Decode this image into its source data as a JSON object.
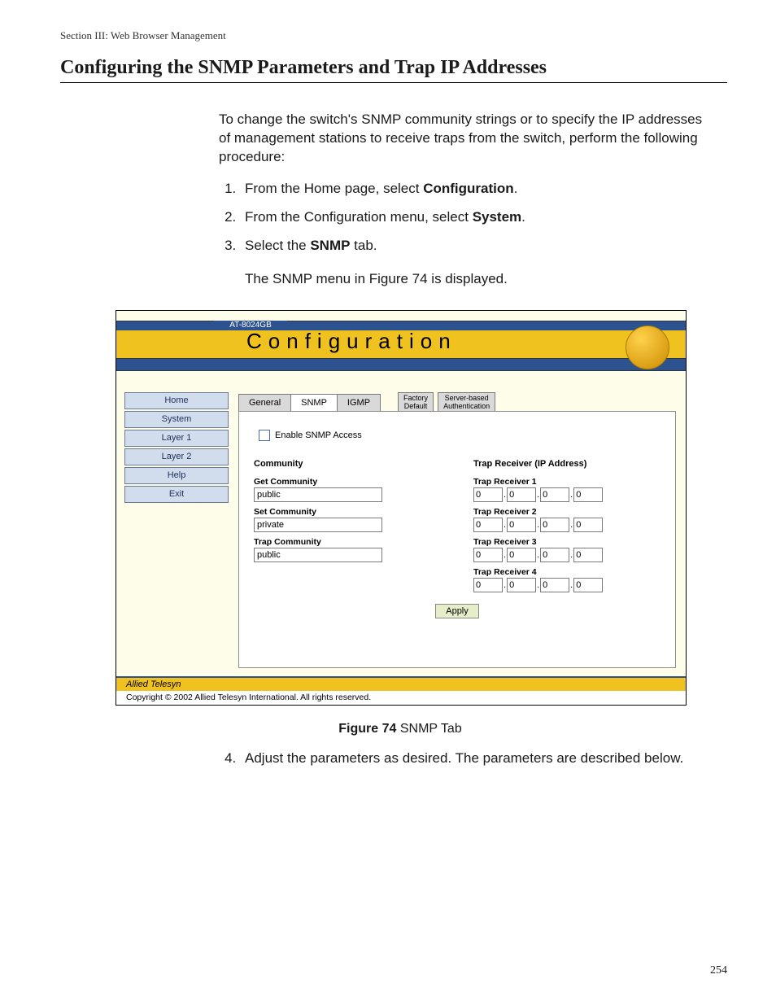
{
  "section_path": "Section III: Web Browser Management",
  "heading": "Configuring the SNMP Parameters and Trap IP Addresses",
  "intro": "To change the switch's SNMP community strings or to specify the IP addresses of management stations to receive traps from the switch, perform the following procedure:",
  "steps": {
    "s1a": "From the Home page, select ",
    "s1b": "Configuration",
    "s1c": ".",
    "s2a": "From the Configuration menu, select ",
    "s2b": "System",
    "s2c": ".",
    "s3a": "Select the ",
    "s3b": "SNMP",
    "s3c": " tab.",
    "s3_follow": "The SNMP menu in Figure 74 is displayed.",
    "s4": "Adjust the parameters as desired. The parameters are described below."
  },
  "figure": {
    "caption_bold": "Figure 74",
    "caption_rest": "  SNMP Tab"
  },
  "ui": {
    "model": "AT-8024GB",
    "title": "Configuration",
    "nav": [
      "Home",
      "System",
      "Layer 1",
      "Layer 2",
      "Help",
      "Exit"
    ],
    "tabs": {
      "general": "General",
      "snmp": "SNMP",
      "igmp": "IGMP",
      "factory_l1": "Factory",
      "factory_l2": "Default",
      "server_l1": "Server-based",
      "server_l2": "Authentication"
    },
    "enable_label": "Enable SNMP Access",
    "community": {
      "heading": "Community",
      "get_label": "Get Community",
      "get_value": "public",
      "set_label": "Set Community",
      "set_value": "private",
      "trap_label": "Trap Community",
      "trap_value": "public"
    },
    "traprecv": {
      "heading": "Trap Receiver (IP Address)",
      "rows": [
        {
          "label": "Trap Receiver 1",
          "o": [
            "0",
            "0",
            "0",
            "0"
          ]
        },
        {
          "label": "Trap Receiver 2",
          "o": [
            "0",
            "0",
            "0",
            "0"
          ]
        },
        {
          "label": "Trap Receiver 3",
          "o": [
            "0",
            "0",
            "0",
            "0"
          ]
        },
        {
          "label": "Trap Receiver 4",
          "o": [
            "0",
            "0",
            "0",
            "0"
          ]
        }
      ]
    },
    "apply": "Apply",
    "brand": "Allied Telesyn",
    "copyright": "Copyright © 2002 Allied Telesyn International. All rights reserved."
  },
  "page_number": "254"
}
